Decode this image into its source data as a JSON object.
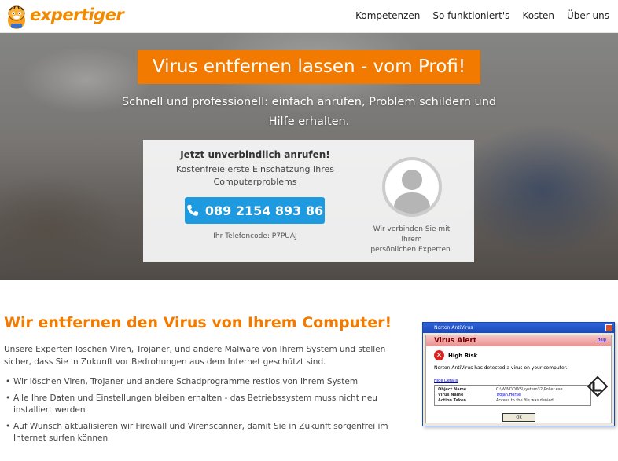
{
  "header": {
    "logo_text": "expertiger",
    "nav": [
      "Kompetenzen",
      "So funktioniert's",
      "Kosten",
      "Über uns"
    ]
  },
  "hero": {
    "title": "Virus entfernen lassen - vom Profi!",
    "subtitle_line1": "Schnell und professionell: einfach anrufen, Problem schildern und",
    "subtitle_line2": "Hilfe erhalten.",
    "card": {
      "heading": "Jetzt unverbindlich anrufen!",
      "text_line1": "Kostenfreie erste Einschätzung Ihres",
      "text_line2": "Computerproblems",
      "phone": "089 2154 893 86",
      "code": "Ihr Telefoncode: P7PUAJ",
      "expert_line1": "Wir verbinden Sie mit Ihrem",
      "expert_line2": "persönlichen Experten."
    }
  },
  "content": {
    "title": "Wir entfernen den Virus von Ihrem Computer!",
    "paragraph": "Unsere Experten löschen Viren, Trojaner, und andere Malware von Ihrem System und stellen sicher, dass Sie in Zukunft vor Bedrohungen aus dem Internet geschützt sind.",
    "bullets": [
      "Wir löschen Viren, Trojaner und andere Schadprogramme restlos von Ihrem System",
      "Alle Ihre Daten und Einstellungen bleiben erhalten - das Betriebssystem muss nicht neu installiert werden",
      "Auf Wunsch aktualisieren wir Firewall und Virenscanner, damit Sie in Zukunft sorgenfrei im Internet surfen können"
    ]
  },
  "norton": {
    "window_title": "Norton AntiVirus",
    "alert_title": "Virus Alert",
    "help": "Help",
    "risk": "High Risk",
    "message": "Norton AntiVirus has detected a virus on your computer.",
    "hide_details": "Hide Details",
    "details": [
      {
        "label": "Object Name",
        "value": "C:\\WINDOWS\\system32\\Poller.exe",
        "link": false
      },
      {
        "label": "Virus Name",
        "value": "Trojan.Horse",
        "link": true
      },
      {
        "label": "Action Taken",
        "value": "Access to the file was denied.",
        "link": false
      }
    ],
    "ok": "OK"
  },
  "colors": {
    "accent": "#f27a00",
    "phone_button": "#1e9be0"
  }
}
